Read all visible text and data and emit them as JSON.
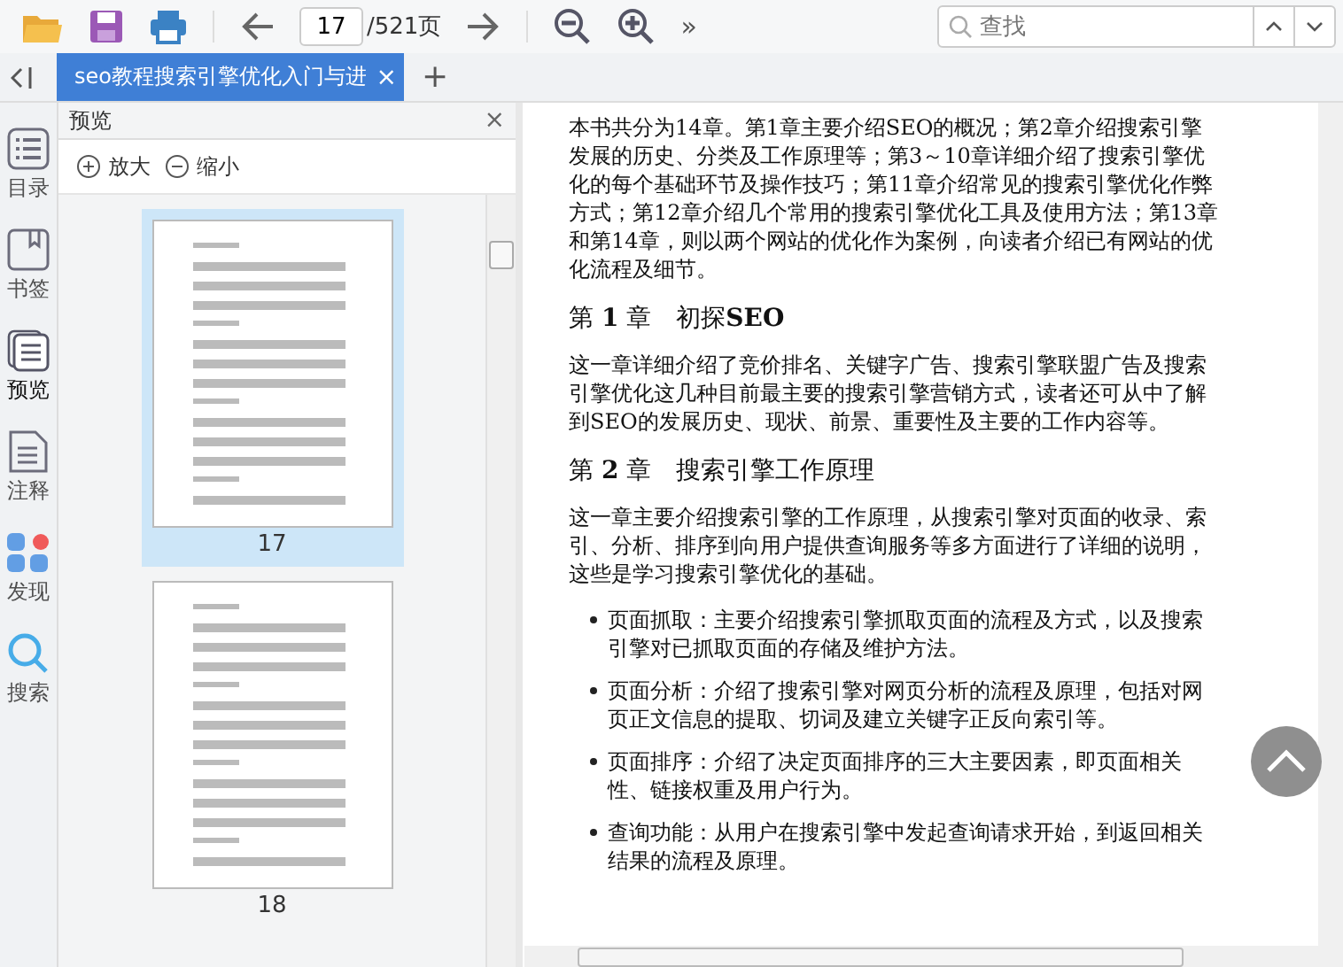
{
  "toolbar": {
    "page_input": "17",
    "page_total": "/521页",
    "more": "»",
    "search": {
      "placeholder": "查找"
    }
  },
  "tabs": [
    {
      "label": "seo教程搜索引擎优化入门与进",
      "selected": true,
      "close": "×"
    }
  ],
  "new_tab": "+",
  "nav": [
    {
      "label": "目录",
      "kind": "toc",
      "selected": false
    },
    {
      "label": "书签",
      "kind": "bookmark",
      "selected": false
    },
    {
      "label": "预览",
      "kind": "preview",
      "selected": true
    },
    {
      "label": "注释",
      "kind": "note",
      "selected": false
    },
    {
      "label": "发现",
      "kind": "discover",
      "selected": false
    },
    {
      "label": "搜索",
      "kind": "search",
      "selected": false
    }
  ],
  "preview_panel": {
    "title": "预览",
    "close": "×",
    "zoom_in": "放大",
    "zoom_out": "缩小",
    "thumbnails": [
      {
        "page": "17",
        "selected": true
      },
      {
        "page": "18",
        "selected": false
      }
    ]
  },
  "document": {
    "blocks": [
      {
        "kind": "para",
        "text": "本书共分为14章。第1章主要介绍SEO的概况；第2章介绍搜索引擎发展的历史、分类及工作原理等；第3～10章详细介绍了搜索引擎优化的每个基础环节及操作技巧；第11章介绍常见的搜索引擎优化作弊方式；第12章介绍几个常用的搜索引擎优化工具及使用方法；第13章和第14章，则以两个网站的优化作为案例，向读者介绍已有网站的优化流程及细节。"
      },
      {
        "kind": "heading",
        "text": "第 **1** 章　初探**SEO**"
      },
      {
        "kind": "para",
        "text": "这一章详细介绍了竞价排名、关键字广告、搜索引擎联盟广告及搜索引擎优化这几种目前最主要的搜索引擎营销方式，读者还可从中了解到SEO的发展历史、现状、前景、重要性及主要的工作内容等。"
      },
      {
        "kind": "heading",
        "text": "第 **2** 章　搜索引擎工作原理"
      },
      {
        "kind": "para",
        "text": "这一章主要介绍搜索引擎的工作原理，从搜索引擎对页面的收录、索引、分析、排序到向用户提供查询服务等多方面进行了详细的说明，这些是学习搜索引擎优化的基础。"
      },
      {
        "kind": "bullet",
        "text": "页面抓取：主要介绍搜索引擎抓取页面的流程及方式，以及搜索引擎对已抓取页面的存储及维护方法。"
      },
      {
        "kind": "bullet",
        "text": "页面分析：介绍了搜索引擎对网页分析的流程及原理，包括对网页正文信息的提取、切词及建立关键字正反向索引等。"
      },
      {
        "kind": "bullet",
        "text": "页面排序：介绍了决定页面排序的三大主要因素，即页面相关性、链接权重及用户行为。"
      },
      {
        "kind": "bullet",
        "text": "查询功能：从用户在搜索引擎中发起查询请求开始，到返回相关结果的流程及原理。"
      }
    ]
  }
}
